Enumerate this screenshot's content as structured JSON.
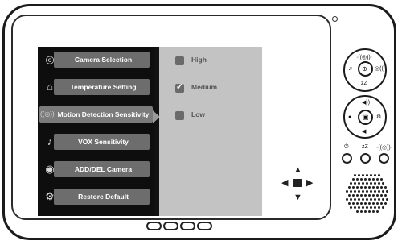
{
  "menu": {
    "items": [
      {
        "label": "Camera Selection",
        "icon": "camera-icon"
      },
      {
        "label": "Temperature Setting",
        "icon": "thermometer-icon"
      },
      {
        "label": "Motion Detection Sensitivity",
        "icon": "motion-sensor-icon"
      },
      {
        "label": "VOX Sensitivity",
        "icon": "vox-icon"
      },
      {
        "label": "ADD/DEL Camera",
        "icon": "add-camera-icon"
      },
      {
        "label": "Restore Default",
        "icon": "gears-icon"
      }
    ],
    "active_index": 2
  },
  "options": {
    "items": [
      {
        "label": "High",
        "checked": false
      },
      {
        "label": "Medium",
        "checked": true
      },
      {
        "label": "Low",
        "checked": false
      }
    ]
  },
  "navigation": {
    "up": "▲",
    "down": "▼",
    "left": "◀",
    "right": "▶"
  },
  "side_panel": {
    "top_ring": {
      "top": "·((◎))·",
      "left": "♫",
      "right": "◎((",
      "bottom": "zZ",
      "center": "🔍"
    },
    "middle_ring": {
      "top": "◀))",
      "left": "●",
      "right": "⚙",
      "bottom": "◀-",
      "center": "▣"
    },
    "small_buttons": [
      {
        "label": "⏻",
        "icon": "power-icon"
      },
      {
        "label": "zZ",
        "icon": "sleep-icon"
      },
      {
        "label": "·((◎))·",
        "icon": "talk-icon"
      }
    ]
  }
}
